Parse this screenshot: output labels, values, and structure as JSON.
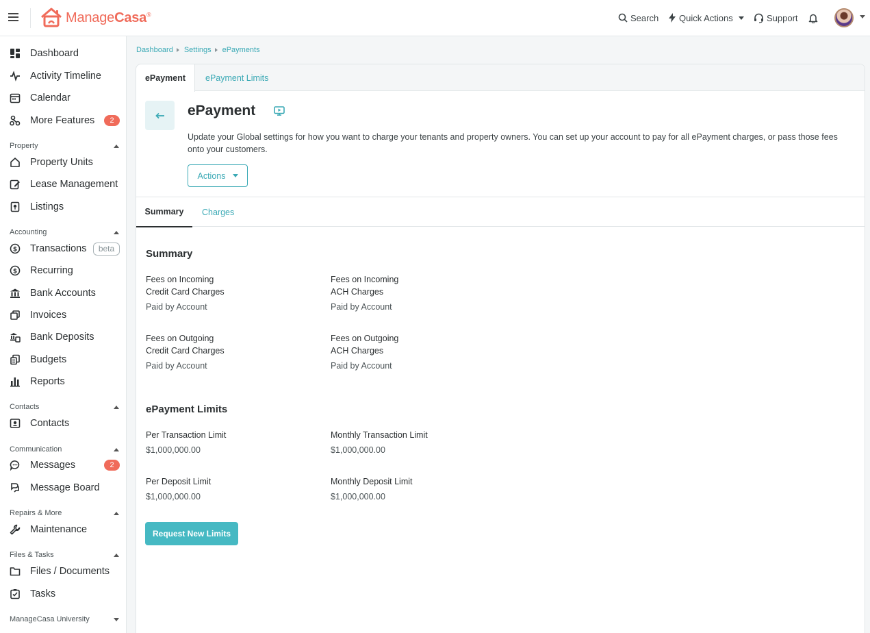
{
  "header": {
    "logo_prefix": "Manage",
    "logo_bold": "Casa",
    "logo_mark": "®",
    "search_label": "Search",
    "quick_actions_label": "Quick Actions",
    "support_label": "Support"
  },
  "sidebar": {
    "top_items": [
      {
        "label": "Dashboard"
      },
      {
        "label": "Activity Timeline"
      },
      {
        "label": "Calendar"
      },
      {
        "label": "More Features",
        "badge": "2"
      }
    ],
    "sections": {
      "property": {
        "label": "Property",
        "items": [
          "Property Units",
          "Lease Management",
          "Listings"
        ]
      },
      "accounting": {
        "label": "Accounting",
        "items": [
          "Transactions",
          "Recurring",
          "Bank Accounts",
          "Invoices",
          "Bank Deposits",
          "Budgets",
          "Reports"
        ],
        "transactions_tag": "beta"
      },
      "contacts": {
        "label": "Contacts",
        "items": [
          "Contacts"
        ]
      },
      "communication": {
        "label": "Communication",
        "items": [
          "Messages",
          "Message Board"
        ],
        "messages_badge": "2"
      },
      "repairs": {
        "label": "Repairs & More",
        "items": [
          "Maintenance"
        ]
      },
      "files": {
        "label": "Files & Tasks",
        "items": [
          "Files / Documents",
          "Tasks"
        ]
      },
      "university": {
        "label": "ManageCasa University"
      }
    }
  },
  "breadcrumb": [
    "Dashboard",
    "Settings",
    "ePayments"
  ],
  "tabs": [
    "ePayment",
    "ePayment Limits"
  ],
  "page": {
    "title": "ePayment",
    "description": "Update your Global settings for how you want to charge your tenants and property owners. You can set up your account to pay for all ePayment charges, or pass those fees onto your customers.",
    "actions_label": "Actions"
  },
  "subtabs": [
    "Summary",
    "Charges"
  ],
  "summary": {
    "title": "Summary",
    "fields": [
      {
        "line1": "Fees on Incoming",
        "line2": "Credit Card Charges",
        "value": "Paid by Account"
      },
      {
        "line1": "Fees on Incoming",
        "line2": "ACH Charges",
        "value": "Paid by Account"
      },
      {
        "line1": "Fees on Outgoing",
        "line2": "Credit Card Charges",
        "value": "Paid by Account"
      },
      {
        "line1": "Fees on Outgoing",
        "line2": "ACH Charges",
        "value": "Paid by Account"
      }
    ]
  },
  "limits": {
    "title": "ePayment Limits",
    "fields": [
      {
        "label": "Per Transaction Limit",
        "value": "$1,000,000.00"
      },
      {
        "label": "Monthly Transaction Limit",
        "value": "$1,000,000.00"
      },
      {
        "label": "Per Deposit Limit",
        "value": "$1,000,000.00"
      },
      {
        "label": "Monthly Deposit Limit",
        "value": "$1,000,000.00"
      }
    ],
    "request_button": "Request New Limits"
  },
  "colors": {
    "brand": "#f06b5a",
    "accent": "#3aa9b5",
    "button": "#46b9c3",
    "badge": "#f06b5a"
  }
}
